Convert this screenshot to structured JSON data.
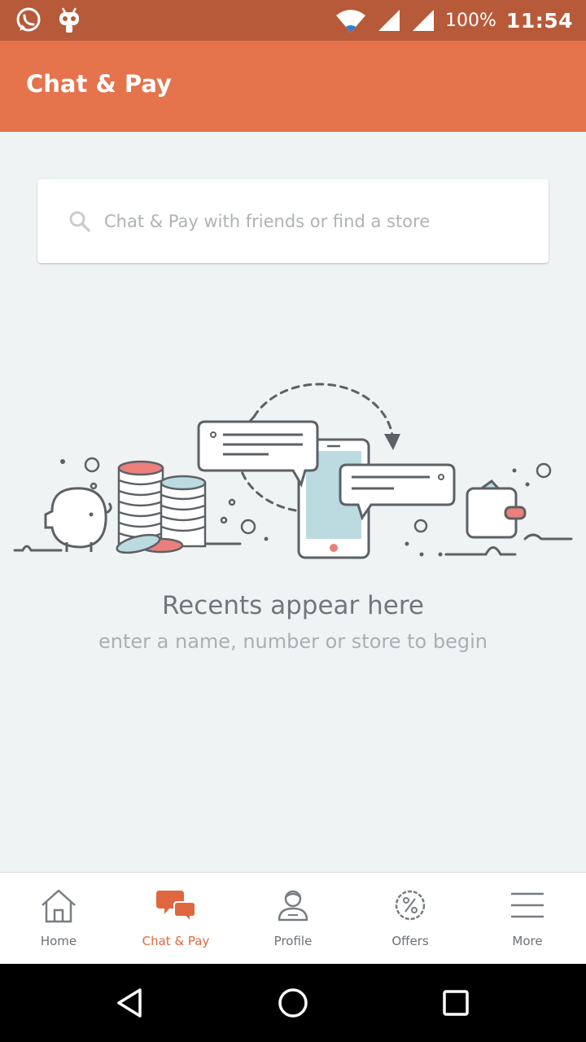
{
  "status_bar": {
    "battery": "100%",
    "time": "11:54",
    "icons": [
      "whatsapp-icon",
      "android-robot-icon",
      "wifi-icon",
      "signal-icon",
      "signal-icon"
    ]
  },
  "app_bar": {
    "title": "Chat & Pay"
  },
  "search": {
    "placeholder": "Chat & Pay with friends or find a store",
    "value": ""
  },
  "empty_state": {
    "title": "Recents appear here",
    "subtitle": "enter a name, number or store to begin"
  },
  "bottom_nav": {
    "items": [
      {
        "label": "Home",
        "icon": "home-icon"
      },
      {
        "label": "Chat & Pay",
        "icon": "chat-bubbles-icon",
        "active": true
      },
      {
        "label": "Profile",
        "icon": "profile-icon"
      },
      {
        "label": "Offers",
        "icon": "offers-percent-icon"
      },
      {
        "label": "More",
        "icon": "menu-icon"
      }
    ]
  },
  "system_nav": {
    "icons": [
      "back-icon",
      "home-circle-icon",
      "recents-icon"
    ]
  },
  "colors": {
    "status_bar": "#b75a3a",
    "app_bar": "#e5734b",
    "active_tab": "#e0673f",
    "background": "#eff3f4"
  }
}
